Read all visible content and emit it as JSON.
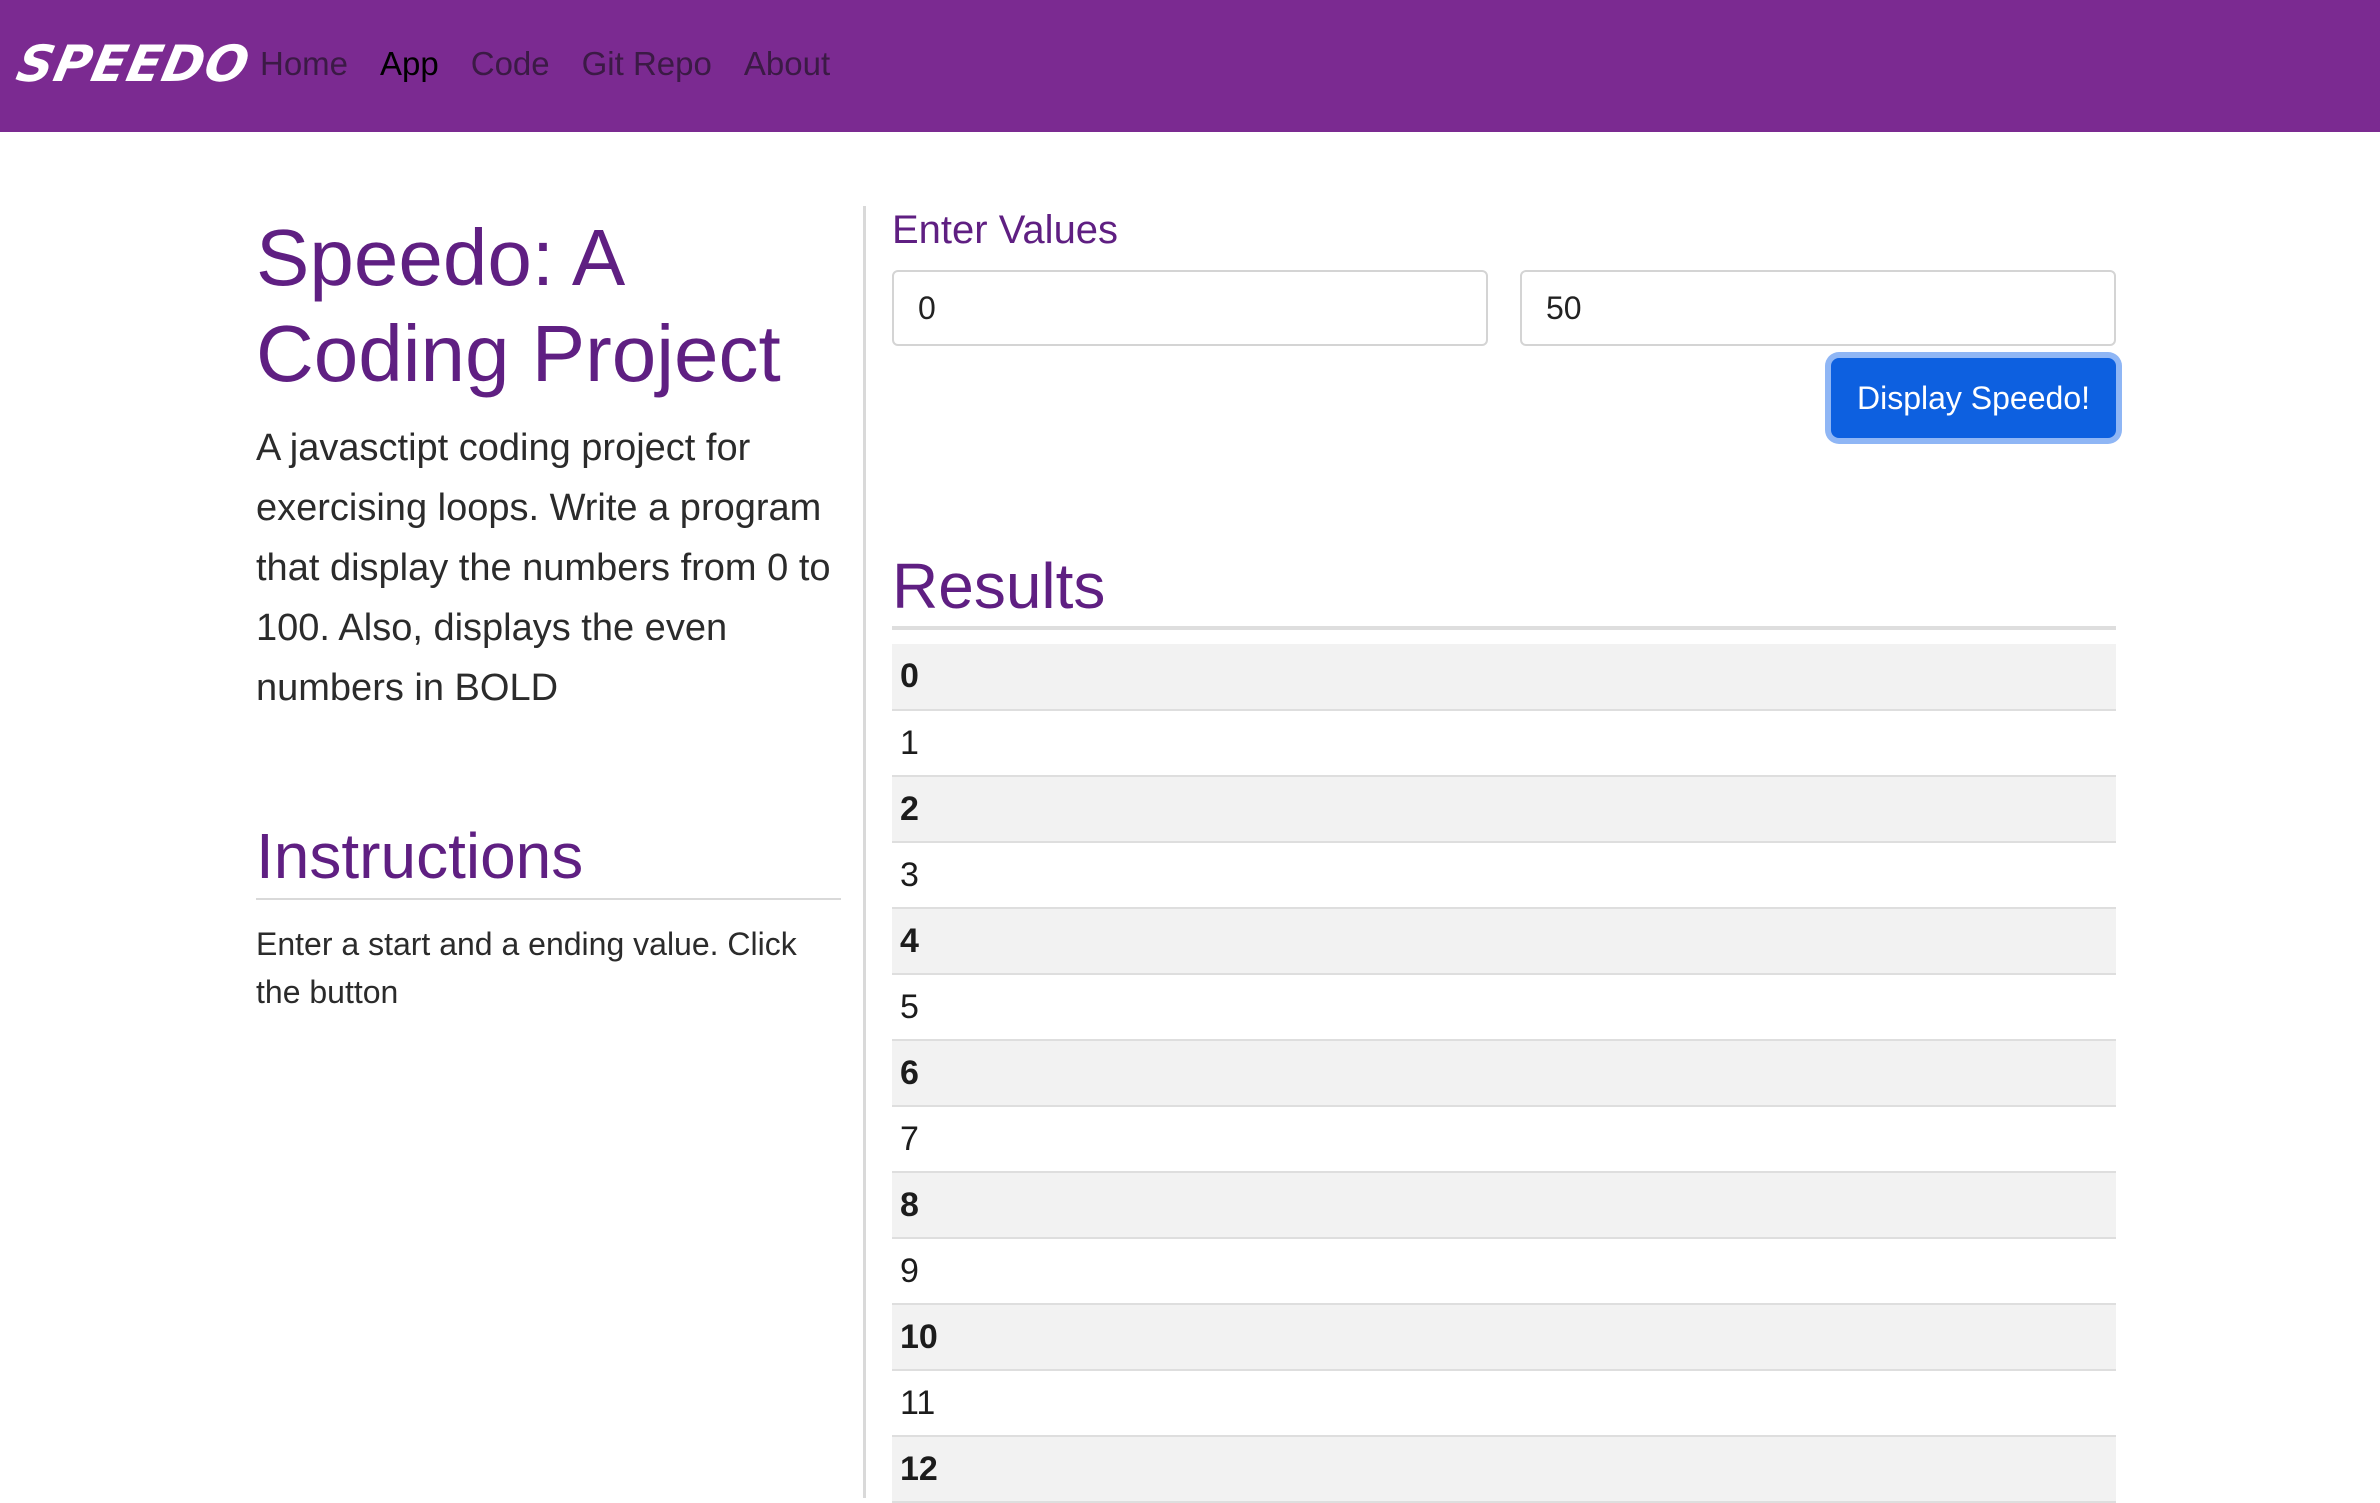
{
  "navbar": {
    "brand": "SPEEDO",
    "links": [
      "Home",
      "App",
      "Code",
      "Git Repo",
      "About"
    ],
    "active": "App"
  },
  "intro": {
    "title": "Speedo: A Coding Project",
    "description": "A javasctipt coding project for exercising loops. Write a program that display the numbers from 0 to 100. Also, displays the even numbers in",
    "description_bold": "BOLD"
  },
  "instructions": {
    "title": "Instructions",
    "text": "Enter a start and a ending value. Click the button"
  },
  "form": {
    "title": "Enter Values",
    "start_value": "0",
    "end_value": "50",
    "button_label": "Display Speedo!"
  },
  "results": {
    "title": "Results",
    "rows": [
      "0",
      "1",
      "2",
      "3",
      "4",
      "5",
      "6",
      "7",
      "8",
      "9",
      "10",
      "11",
      "12"
    ]
  },
  "colors": {
    "navbar": "#7b2a91",
    "heading": "#5f1f82",
    "button": "#0d60e0"
  }
}
